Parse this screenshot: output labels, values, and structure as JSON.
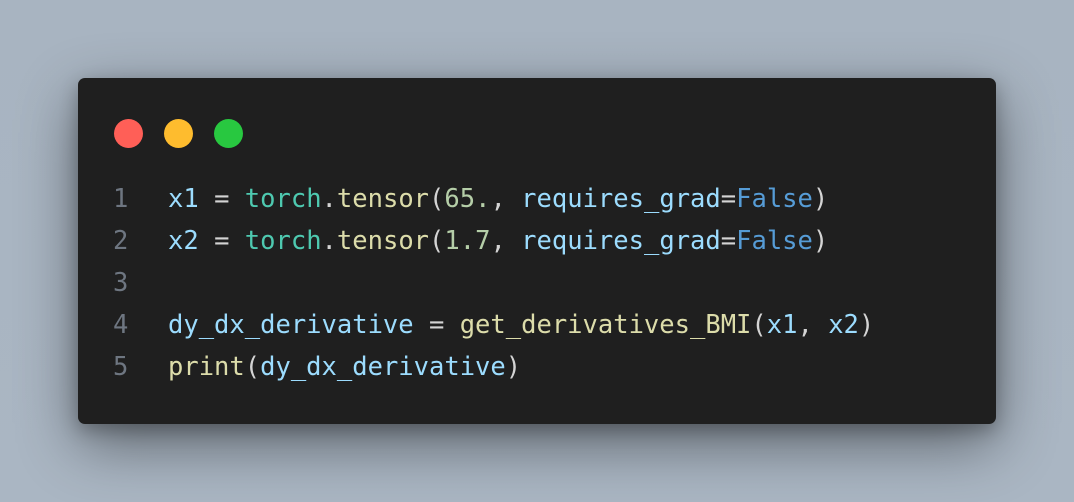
{
  "window": {
    "controls": [
      {
        "name": "close",
        "color": "#ff5f57"
      },
      {
        "name": "minimize",
        "color": "#febc2e"
      },
      {
        "name": "zoom",
        "color": "#28c840"
      }
    ]
  },
  "code": {
    "language": "python",
    "lines": [
      {
        "number": "1",
        "tokens": [
          {
            "t": "x1",
            "c": "v"
          },
          {
            "t": " = ",
            "c": "op"
          },
          {
            "t": "torch",
            "c": "cls"
          },
          {
            "t": ".",
            "c": "op"
          },
          {
            "t": "tensor",
            "c": "fn"
          },
          {
            "t": "(",
            "c": "op"
          },
          {
            "t": "65.",
            "c": "num"
          },
          {
            "t": ", ",
            "c": "op"
          },
          {
            "t": "requires_grad",
            "c": "v"
          },
          {
            "t": "=",
            "c": "op"
          },
          {
            "t": "False",
            "c": "kw"
          },
          {
            "t": ")",
            "c": "op"
          }
        ]
      },
      {
        "number": "2",
        "tokens": [
          {
            "t": "x2",
            "c": "v"
          },
          {
            "t": " = ",
            "c": "op"
          },
          {
            "t": "torch",
            "c": "cls"
          },
          {
            "t": ".",
            "c": "op"
          },
          {
            "t": "tensor",
            "c": "fn"
          },
          {
            "t": "(",
            "c": "op"
          },
          {
            "t": "1.7",
            "c": "num"
          },
          {
            "t": ", ",
            "c": "op"
          },
          {
            "t": "requires_grad",
            "c": "v"
          },
          {
            "t": "=",
            "c": "op"
          },
          {
            "t": "False",
            "c": "kw"
          },
          {
            "t": ")",
            "c": "op"
          }
        ]
      },
      {
        "number": "3",
        "tokens": []
      },
      {
        "number": "4",
        "tokens": [
          {
            "t": "dy_dx_derivative",
            "c": "v"
          },
          {
            "t": " = ",
            "c": "op"
          },
          {
            "t": "get_derivatives_BMI",
            "c": "fn"
          },
          {
            "t": "(",
            "c": "op"
          },
          {
            "t": "x1",
            "c": "v"
          },
          {
            "t": ", ",
            "c": "op"
          },
          {
            "t": "x2",
            "c": "v"
          },
          {
            "t": ")",
            "c": "op"
          }
        ]
      },
      {
        "number": "5",
        "tokens": [
          {
            "t": "print",
            "c": "fn"
          },
          {
            "t": "(",
            "c": "op"
          },
          {
            "t": "dy_dx_derivative",
            "c": "v"
          },
          {
            "t": ")",
            "c": "op"
          }
        ]
      }
    ]
  }
}
